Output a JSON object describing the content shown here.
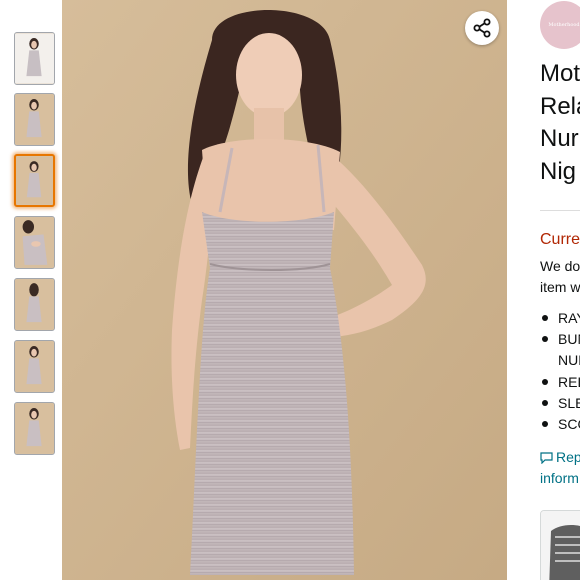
{
  "thumbnails": [
    {
      "label": "front view",
      "selected": false
    },
    {
      "label": "front view 2",
      "selected": false
    },
    {
      "label": "front view 3",
      "selected": true
    },
    {
      "label": "nursing view",
      "selected": false
    },
    {
      "label": "back view",
      "selected": false
    },
    {
      "label": "side view",
      "selected": false
    },
    {
      "label": "detail view",
      "selected": false
    }
  ],
  "brand": {
    "logo_text": "Motherhood"
  },
  "product": {
    "title_lines": [
      "Mot",
      "Rela",
      "Nur",
      "Nig"
    ]
  },
  "availability": {
    "status": "Curre",
    "text_lines": [
      "We do",
      "item w"
    ]
  },
  "features": [
    "RAY",
    "BUN",
    "NUR",
    "REL",
    "SLE",
    "SCO"
  ],
  "report": {
    "line1": "Rep",
    "line2": "inform"
  },
  "icons": {
    "share": "share-icon",
    "report": "comment-icon"
  },
  "colors": {
    "accent_selected": "#e77600",
    "availability": "#b12704",
    "link": "#007185",
    "text": "#0f1111",
    "image_background": "#cfb591"
  }
}
